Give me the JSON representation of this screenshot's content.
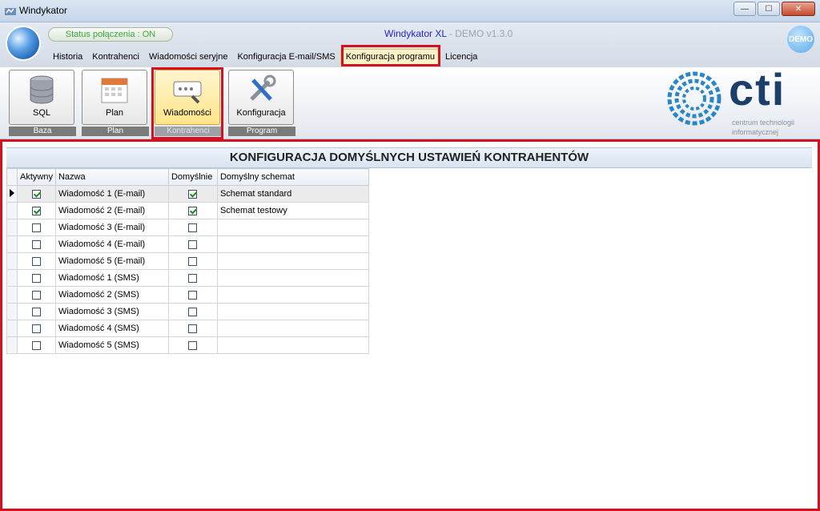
{
  "window": {
    "title": "Windykator",
    "minimize": "—",
    "maximize": "☐",
    "close": "✕"
  },
  "header": {
    "status": "Status połączenia : ON",
    "app_name": "Windykator XL",
    "app_version": " - DEMO v1.3.0",
    "demo_badge": "DEMO"
  },
  "menu": {
    "items": [
      {
        "label": "Historia"
      },
      {
        "label": "Kontrahenci"
      },
      {
        "label": "Wiadomości seryjne"
      },
      {
        "label": "Konfiguracja E-mail/SMS"
      },
      {
        "label": "Konfiguracja programu"
      },
      {
        "label": "Licencja"
      }
    ],
    "active_index": 4
  },
  "ribbon": {
    "buttons": [
      {
        "label": "SQL",
        "group": "Baza",
        "icon": "database-icon"
      },
      {
        "label": "Plan",
        "group": "Plan",
        "icon": "calendar-icon"
      },
      {
        "label": "Wiadomości",
        "group": "Kontrahenci",
        "icon": "message-wrench-icon"
      },
      {
        "label": "Konfiguracja",
        "group": "Program",
        "icon": "tools-icon"
      }
    ],
    "active_index": 2
  },
  "logo": {
    "word": "cti",
    "line1": "centrum technologii",
    "line2": "informatycznej"
  },
  "grid": {
    "title": "KONFIGURACJA DOMYŚLNYCH USTAWIEŃ KONTRAHENTÓW",
    "columns": [
      "Aktywny",
      "Nazwa",
      "Domyślnie",
      "Domyślny schemat"
    ],
    "rows": [
      {
        "aktywny": true,
        "nazwa": "Wiadomość 1 (E-mail)",
        "domyslnie": true,
        "schemat": "Schemat standard"
      },
      {
        "aktywny": true,
        "nazwa": "Wiadomość 2 (E-mail)",
        "domyslnie": true,
        "schemat": "Schemat testowy"
      },
      {
        "aktywny": false,
        "nazwa": "Wiadomość 3 (E-mail)",
        "domyslnie": false,
        "schemat": ""
      },
      {
        "aktywny": false,
        "nazwa": "Wiadomość 4 (E-mail)",
        "domyslnie": false,
        "schemat": ""
      },
      {
        "aktywny": false,
        "nazwa": "Wiadomość 5 (E-mail)",
        "domyslnie": false,
        "schemat": ""
      },
      {
        "aktywny": false,
        "nazwa": "Wiadomość 1 (SMS)",
        "domyslnie": false,
        "schemat": ""
      },
      {
        "aktywny": false,
        "nazwa": "Wiadomość 2 (SMS)",
        "domyslnie": false,
        "schemat": ""
      },
      {
        "aktywny": false,
        "nazwa": "Wiadomość 3 (SMS)",
        "domyslnie": false,
        "schemat": ""
      },
      {
        "aktywny": false,
        "nazwa": "Wiadomość 4 (SMS)",
        "domyslnie": false,
        "schemat": ""
      },
      {
        "aktywny": false,
        "nazwa": "Wiadomość 5 (SMS)",
        "domyslnie": false,
        "schemat": ""
      }
    ],
    "current_row": 0
  },
  "colors": {
    "highlight": "#d4121f",
    "status_green": "#3aa63a",
    "app_name_blue": "#2323d0",
    "logo_blue": "#1c3f6a"
  }
}
